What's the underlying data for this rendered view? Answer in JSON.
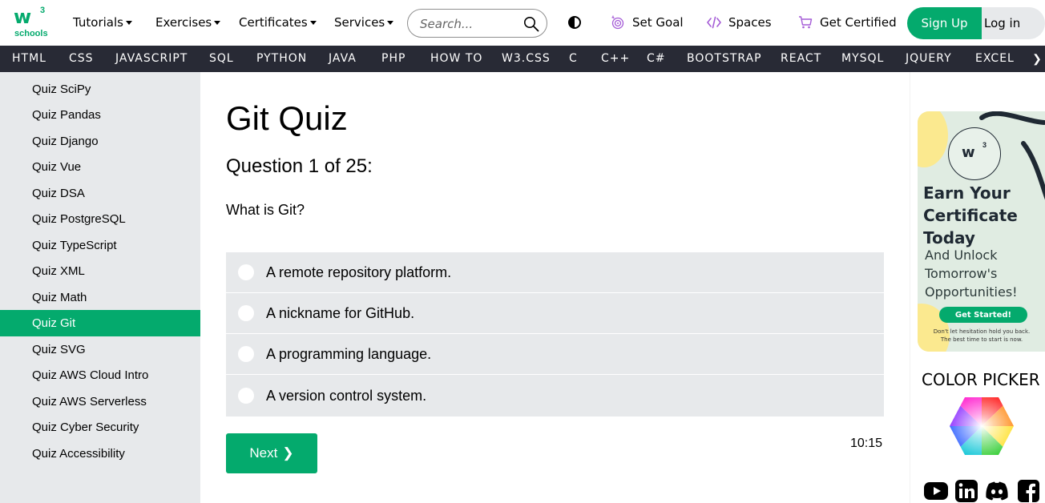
{
  "header": {
    "logo_text": "w",
    "logo_sup": "3",
    "logo_word": "schools",
    "nav": [
      {
        "label": "Tutorials"
      },
      {
        "label": "Exercises"
      },
      {
        "label": "Certificates"
      },
      {
        "label": "Services"
      }
    ],
    "search_placeholder": "Search...",
    "set_goal": "Set Goal",
    "spaces": "Spaces",
    "get_certified": "Get Certified",
    "sign_up": "Sign Up",
    "log_in": "Log in"
  },
  "langbar": {
    "items": [
      "HTML",
      "CSS",
      "JAVASCRIPT",
      "SQL",
      "PYTHON",
      "JAVA",
      "PHP",
      "HOW TO",
      "W3.CSS",
      "C",
      "C++",
      "C#",
      "BOOTSTRAP",
      "REACT",
      "MYSQL",
      "JQUERY",
      "EXCEL"
    ],
    "next": "❯"
  },
  "sidebar": {
    "items": [
      {
        "label": "Quiz SciPy"
      },
      {
        "label": "Quiz Pandas"
      },
      {
        "label": "Quiz Django"
      },
      {
        "label": "Quiz Vue"
      },
      {
        "label": "Quiz DSA"
      },
      {
        "label": "Quiz PostgreSQL"
      },
      {
        "label": "Quiz TypeScript"
      },
      {
        "label": "Quiz XML"
      },
      {
        "label": "Quiz Math"
      },
      {
        "label": "Quiz Git",
        "active": true
      },
      {
        "label": "Quiz SVG"
      },
      {
        "label": "Quiz AWS Cloud Intro"
      },
      {
        "label": "Quiz AWS Serverless"
      },
      {
        "label": "Quiz Cyber Security"
      },
      {
        "label": "Quiz Accessibility"
      }
    ]
  },
  "quiz": {
    "title": "Git Quiz",
    "question_count": "Question 1 of 25:",
    "question": "What is Git?",
    "options": [
      "A remote repository platform.",
      "A nickname for GitHub.",
      "A programming language.",
      "A version control system."
    ],
    "next_label": "Next",
    "next_arrow": "❯",
    "timer": "10:15"
  },
  "ad": {
    "badge_mark": "w",
    "badge_sup": "3",
    "headline": [
      "Earn Your",
      "Certificate",
      "Today"
    ],
    "subline": [
      "And Unlock",
      "Tomorrow's",
      "Opportunities!"
    ],
    "button": "Get Started!",
    "small": [
      "Don't let hesitation hold you back.",
      "The best time to start is now."
    ]
  },
  "right": {
    "color_picker_title": "COLOR PICKER"
  },
  "colors": {
    "accent": "#04AA6D",
    "dark_bar": "#282A35",
    "panel_gray": "#E7E9EB"
  },
  "icons": {
    "search": "search-icon",
    "contrast": "contrast-icon",
    "goal": "target-icon",
    "spaces": "code-icon",
    "certified": "cart-icon",
    "social": [
      "youtube-icon",
      "linkedin-icon",
      "discord-icon",
      "facebook-icon"
    ]
  }
}
